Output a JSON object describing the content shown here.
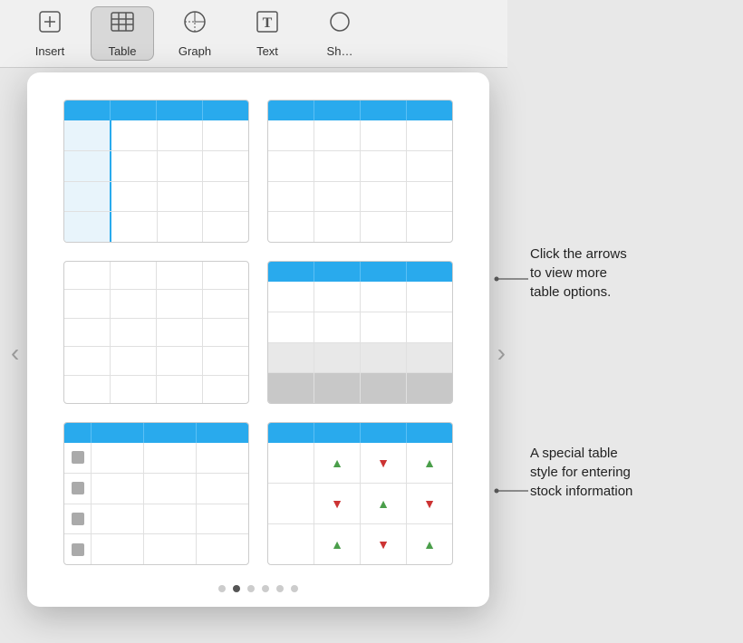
{
  "toolbar": {
    "buttons": [
      {
        "id": "insert",
        "label": "Insert",
        "icon": "⊞",
        "active": false
      },
      {
        "id": "table",
        "label": "Table",
        "icon": "⊞",
        "active": true
      },
      {
        "id": "graph",
        "label": "Graph",
        "icon": "◔",
        "active": false
      },
      {
        "id": "text",
        "label": "Text",
        "icon": "T",
        "active": false
      },
      {
        "id": "shape",
        "label": "Sh…",
        "icon": "◯",
        "active": false
      }
    ]
  },
  "popup": {
    "nav_left": "‹",
    "nav_right": "›"
  },
  "annotations": {
    "arrow_hint": "Click the arrows\nto view more\ntable options.",
    "stock_hint": "A special table\nstyle for entering\nstock information"
  },
  "dots": {
    "count": 6,
    "active_index": 1
  }
}
